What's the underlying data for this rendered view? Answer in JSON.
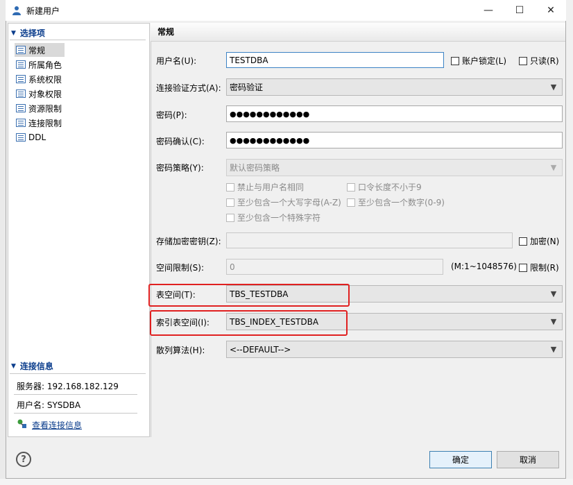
{
  "window": {
    "title": "新建用户",
    "minimize_glyph": "—",
    "maximize_glyph": "☐",
    "close_glyph": "✕"
  },
  "nav": {
    "section_label": "选择项",
    "items": [
      {
        "label": "常规",
        "selected": true
      },
      {
        "label": "所属角色",
        "selected": false
      },
      {
        "label": "系统权限",
        "selected": false
      },
      {
        "label": "对象权限",
        "selected": false
      },
      {
        "label": "资源限制",
        "selected": false
      },
      {
        "label": "连接限制",
        "selected": false
      },
      {
        "label": "DDL",
        "selected": false
      }
    ]
  },
  "connection": {
    "section_label": "连接信息",
    "server": "服务器: 192.168.182.129",
    "user": "用户名: SYSDBA",
    "view_link": "查看连接信息"
  },
  "form": {
    "header": "常规",
    "username_label": "用户名(U):",
    "username_value": "TESTDBA",
    "lock_label": "账户锁定(L)",
    "readonly_label": "只读(R)",
    "auth_label": "连接验证方式(A):",
    "auth_value": "密码验证",
    "password_label": "密码(P):",
    "password_value": "●●●●●●●●●●●●",
    "confirm_label": "密码确认(C):",
    "confirm_value": "●●●●●●●●●●●●",
    "policy_label": "密码策略(Y):",
    "policy_value": "默认密码策略",
    "policy_options": [
      "禁止与用户名相同",
      "口令长度不小于9",
      "至少包含一个大写字母(A-Z)",
      "至少包含一个数字(0-9)",
      "至少包含一个特殊字符"
    ],
    "storekey_label": "存储加密密钥(Z):",
    "encrypt_label": "加密(N)",
    "spacelimit_label": "空间限制(S):",
    "spacelimit_value": "0",
    "spacelimit_range": "(M:1~1048576)",
    "limit_label": "限制(R)",
    "tablespace_label": "表空间(T):",
    "tablespace_value": "TBS_TESTDBA",
    "indexspace_label": "索引表空间(I):",
    "indexspace_value": "TBS_INDEX_TESTDBA",
    "hash_label": "散列算法(H):",
    "hash_value": "<--DEFAULT-->"
  },
  "footer": {
    "help_glyph": "?",
    "ok_label": "确定",
    "cancel_label": "取消"
  },
  "colors": {
    "highlight_border": "#e02020",
    "link": "#0b3d8c",
    "focus_border": "#3b82c4"
  }
}
